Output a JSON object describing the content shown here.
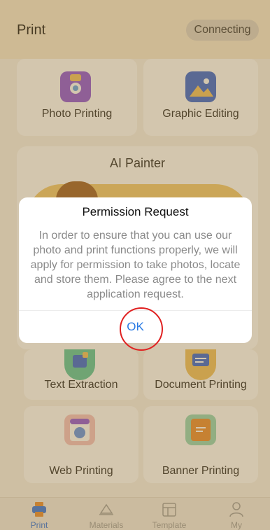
{
  "header": {
    "title": "Print",
    "status_button": "Connecting"
  },
  "cards": {
    "photo_printing": "Photo Printing",
    "graphic_editing": "Graphic Editing",
    "text_extraction": "Text Extraction",
    "document_printing": "Document Printing",
    "web_printing": "Web Printing",
    "banner_printing": "Banner Printing"
  },
  "ai_painter": {
    "title": "AI Painter"
  },
  "dialog": {
    "title": "Permission Request",
    "body": "In order to ensure that you can use our photo and print functions properly, we will apply for permission to take photos, locate and store them. Please agree to the next application request.",
    "ok_label": "OK"
  },
  "tabbar": {
    "tabs": [
      {
        "label": "Print",
        "icon": "printer-icon",
        "active": true
      },
      {
        "label": "Materials",
        "icon": "materials-icon",
        "active": false
      },
      {
        "label": "Template",
        "icon": "template-icon",
        "active": false
      },
      {
        "label": "My",
        "icon": "user-icon",
        "active": false
      }
    ]
  },
  "colors": {
    "accent": "#2a7be4",
    "highlight_ring": "#e02020",
    "overlay": "#96763e"
  }
}
